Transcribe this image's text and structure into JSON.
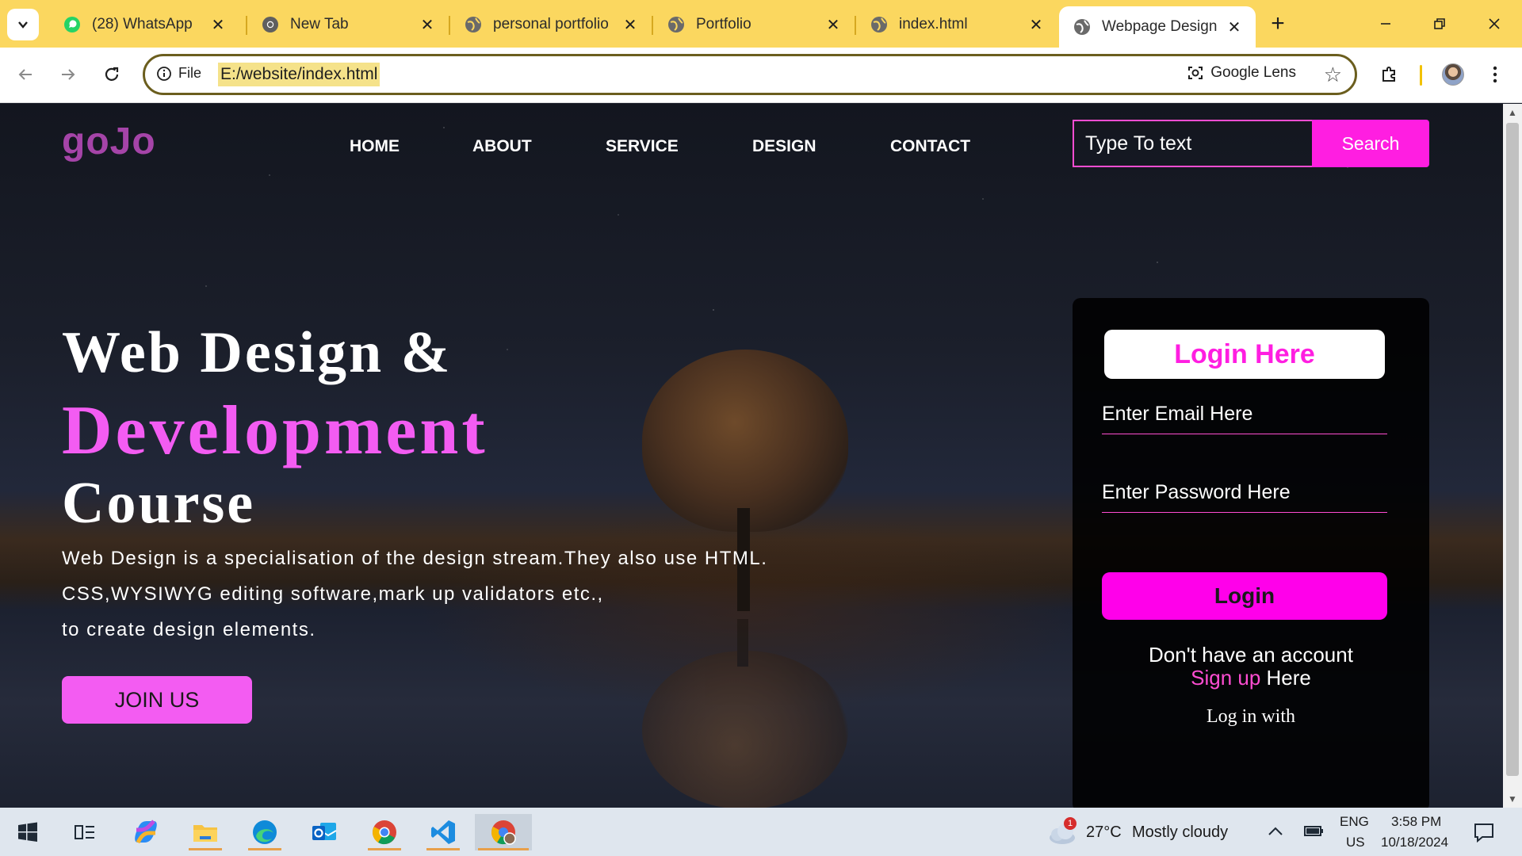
{
  "browser": {
    "tabs": [
      {
        "title": "(28) WhatsApp",
        "icon": "whatsapp-icon"
      },
      {
        "title": "New Tab",
        "icon": "chrome-icon"
      },
      {
        "title": "personal portfolio",
        "icon": "globe-icon"
      },
      {
        "title": "Portfolio",
        "icon": "globe-icon"
      },
      {
        "title": "index.html",
        "icon": "globe-icon"
      },
      {
        "title": "Webpage Design",
        "icon": "globe-icon",
        "active": true
      }
    ],
    "address": {
      "scheme_label": "File",
      "url": "E:/website/index.html"
    },
    "lens_label": "Google Lens"
  },
  "site": {
    "logo": "goJo",
    "nav": [
      "HOME",
      "ABOUT",
      "SERVICE",
      "DESIGN",
      "CONTACT"
    ],
    "search": {
      "placeholder": "Type To text",
      "button": "Search"
    },
    "hero": {
      "line1": "Web Design &",
      "line2": "Development",
      "line3": "Course",
      "para1": "Web Design is a specialisation of the design stream.They also use HTML.",
      "para2": "CSS,WYSIWYG editing software,mark up validators etc.,",
      "para3": "to create design elements.",
      "cta": "JOIN US"
    },
    "login": {
      "title": "Login Here",
      "email_placeholder": "Enter Email Here",
      "password_placeholder": "Enter Password Here",
      "button": "Login",
      "no_account": "Don't have an account",
      "signup_link": "Sign up",
      "signup_rest": " Here",
      "login_with": "Log in with"
    },
    "colors": {
      "accent": "#ff1ee1",
      "hero_pink": "#f35cf2",
      "logo": "#a544a8"
    }
  },
  "taskbar": {
    "weather": {
      "temp": "27°C",
      "desc": "Mostly cloudy",
      "badge": "1"
    },
    "lang": {
      "top": "ENG",
      "bottom": "US"
    },
    "clock": {
      "time": "3:58 PM",
      "date": "10/18/2024"
    }
  }
}
